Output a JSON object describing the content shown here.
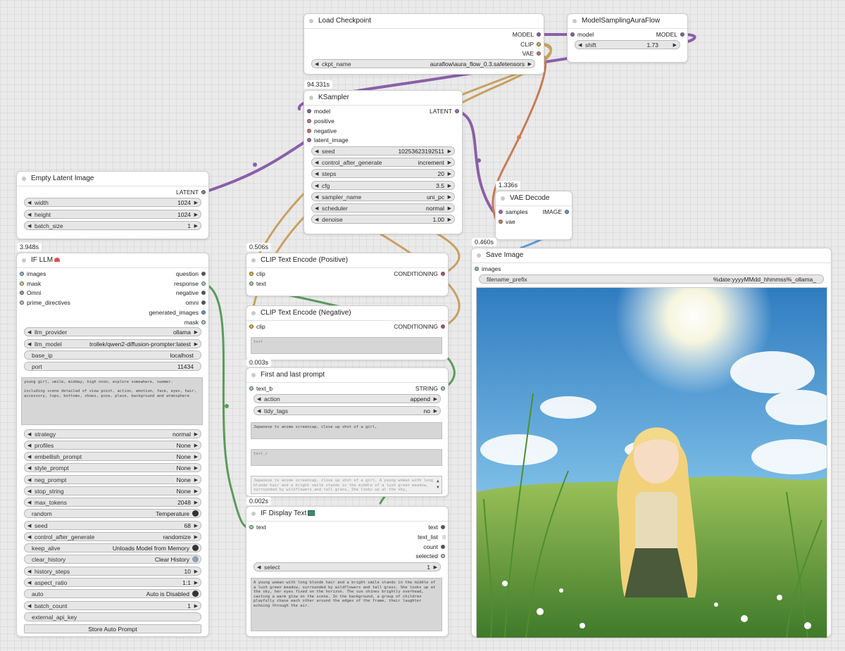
{
  "nodes": {
    "load_checkpoint": {
      "title": "Load Checkpoint",
      "outputs": [
        "MODEL",
        "CLIP",
        "VAE"
      ],
      "widget": {
        "label": "ckpt_name",
        "value": "auraflow\\aura_flow_0.3.safetensors"
      }
    },
    "model_sampling": {
      "title": "ModelSamplingAuraFlow",
      "input": "model",
      "output": "MODEL",
      "widget": {
        "label": "shift",
        "value": "1.73"
      }
    },
    "ksampler": {
      "timing": "94.331s",
      "title": "KSampler",
      "inputs": [
        "model",
        "positive",
        "negative",
        "latent_image"
      ],
      "output": "LATENT",
      "widgets": [
        {
          "label": "seed",
          "value": "10253623192511"
        },
        {
          "label": "control_after_generate",
          "value": "increment"
        },
        {
          "label": "steps",
          "value": "20"
        },
        {
          "label": "cfg",
          "value": "3.5"
        },
        {
          "label": "sampler_name",
          "value": "uni_pc"
        },
        {
          "label": "scheduler",
          "value": "normal"
        },
        {
          "label": "denoise",
          "value": "1.00"
        }
      ]
    },
    "empty_latent": {
      "title": "Empty Latent Image",
      "output": "LATENT",
      "widgets": [
        {
          "label": "width",
          "value": "1024"
        },
        {
          "label": "height",
          "value": "1024"
        },
        {
          "label": "batch_size",
          "value": "1"
        }
      ]
    },
    "vae_decode": {
      "timing": "1.336s",
      "title": "VAE Decode",
      "inputs": [
        "samples",
        "vae"
      ],
      "output": "IMAGE"
    },
    "if_llm": {
      "timing": "3.948s",
      "title": "IF LLM",
      "inputs": [
        "images",
        "mask",
        "Omni",
        "prime_directives"
      ],
      "outputs": [
        "question",
        "response",
        "negative",
        "omni",
        "generated_images",
        "mask"
      ],
      "widgets_top": [
        {
          "label": "llm_provider",
          "value": "ollama"
        },
        {
          "label": "llm_model",
          "value": "trollek/qwen2-diffusion-prompter:latest"
        }
      ],
      "plain_top": [
        {
          "label": "base_ip",
          "value": "localhost"
        },
        {
          "label": "port",
          "value": "11434"
        }
      ],
      "prompt_text": "young girl, smile, midday, high noon, explore somewhere, summer.\n\nincluding scene detailed of view point, action, emotion, face, eyes, hair, accessory, tops, bottoms, shoes, pose, place, background and atmosphere",
      "widgets_mid": [
        {
          "label": "strategy",
          "value": "normal"
        },
        {
          "label": "profiles",
          "value": "None"
        },
        {
          "label": "embellish_prompt",
          "value": "None"
        },
        {
          "label": "style_prompt",
          "value": "None"
        },
        {
          "label": "neg_prompt",
          "value": "None"
        },
        {
          "label": "stop_string",
          "value": "None"
        },
        {
          "label": "max_tokens",
          "value": "2048"
        }
      ],
      "random": {
        "label": "random",
        "value": "Temperature"
      },
      "widgets_seed": [
        {
          "label": "seed",
          "value": "68"
        },
        {
          "label": "control_after_generate",
          "value": "randomize"
        }
      ],
      "keep_alive": {
        "label": "keep_alive",
        "value": "Unloads Model from Memory"
      },
      "clear_history": {
        "label": "clear_history",
        "value": "Clear History"
      },
      "widgets_hist": [
        {
          "label": "history_steps",
          "value": "10"
        },
        {
          "label": "aspect_ratio",
          "value": "1:1"
        }
      ],
      "auto": {
        "label": "auto",
        "value": "Auto is Disabled"
      },
      "batch_count": {
        "label": "batch_count",
        "value": "1"
      },
      "external_api_key": {
        "label": "external_api_key"
      },
      "store_button": "Store Auto Prompt"
    },
    "clip_positive": {
      "timing": "0.506s",
      "title": "CLIP Text Encode (Positive)",
      "inputs": [
        "clip",
        "text"
      ],
      "output": "CONDITIONING"
    },
    "clip_negative": {
      "title": "CLIP Text Encode (Negative)",
      "input": "clip",
      "output": "CONDITIONING",
      "placeholder": "text"
    },
    "first_last": {
      "timing": "0.003s",
      "title": "First and last prompt",
      "input": "text_b",
      "output": "STRING",
      "widgets": [
        {
          "label": "action",
          "value": "append"
        },
        {
          "label": "tidy_tags",
          "value": "no"
        }
      ],
      "text_a": "Japanese tv anime screencap, close up shot of a girl,",
      "text_c_placeholder": "text_c",
      "preview": "Japanese tv anime screencap, close up shot of a girl, A young woman with long blonde hair and a bright smile stands in the middle of a lush green meadow, surrounded by wildflowers and tall grass. She looks up at the sky,"
    },
    "display_text": {
      "timing": "0.002s",
      "title": "IF Display Text",
      "input": "text",
      "outputs": [
        "text",
        "text_list",
        "count",
        "selected"
      ],
      "widget": {
        "label": "select",
        "value": "1"
      },
      "text": "A young woman with long blonde hair and a bright smile stands in the middle of a lush green meadow, surrounded by wildflowers and tall grass. She looks up at the sky, her eyes fixed on the horizon. The sun shines brightly overhead, casting a warm glow on the scene. In the background, a group of children playfully chase each other around the edges of the frame, their laughter echoing through the air."
    },
    "save_image": {
      "timing": "0.460s",
      "title": "Save Image",
      "input": "images",
      "widget": {
        "label": "filename_prefix",
        "value": "%date:yyyyMMdd_hhmmss%_ollama_"
      }
    }
  },
  "colors": {
    "model": "#8a5fa8",
    "clip": "#e0a040",
    "vae": "#e07050",
    "latent": "#a866c0",
    "conditioning": "#c05050",
    "string": "#5c9a5c",
    "image": "#5b9bd5"
  }
}
